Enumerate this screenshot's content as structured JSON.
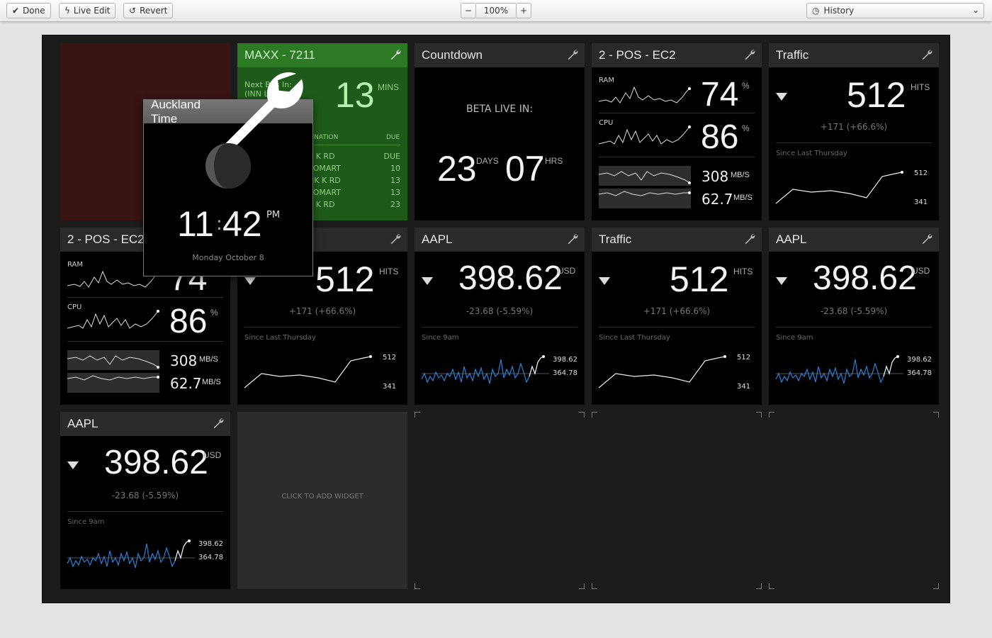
{
  "toolbar": {
    "done_label": "Done",
    "live_edit_label": "Live Edit",
    "revert_label": "Revert",
    "zoom_minus": "−",
    "zoom_value": "100%",
    "zoom_plus": "+",
    "history_label": "History"
  },
  "widgets": {
    "bus": {
      "title": "MAXX - 7211",
      "next_label": "Next Bus In:",
      "route": "(INN LNK)",
      "minutes": "13",
      "minutes_unit": "MINS",
      "col_destination": "TINATION",
      "col_due": "DUE",
      "rows": [
        {
          "dest": "K K RD",
          "due": "DUE"
        },
        {
          "dest": "TOMART",
          "due": "10"
        },
        {
          "dest": "NK K RD",
          "due": "13"
        },
        {
          "dest": "TOMART",
          "due": "13"
        },
        {
          "dest": "K K RD",
          "due": "23"
        }
      ]
    },
    "countdown": {
      "title": "Countdown",
      "caption": "BETA LIVE IN:",
      "days": "23",
      "days_unit": "DAYS",
      "hours": "07",
      "hours_unit": "HRS"
    },
    "pos1": {
      "title": "2 - POS - EC2",
      "ram_label": "RAM",
      "ram_value": "74",
      "cpu_label": "CPU",
      "cpu_value": "86",
      "pct": "%",
      "net1_value": "308",
      "net2_value": "62.7",
      "net_unit": "MB/S"
    },
    "pos2": {
      "title": "2 - POS - EC2",
      "ram_label": "RAM",
      "ram_value": "74",
      "cpu_label": "CPU",
      "cpu_value": "86",
      "pct": "%",
      "net1_value": "308",
      "net2_value": "62.7",
      "net_unit": "MB/S"
    },
    "traffic": {
      "title": "Traffic",
      "value": "512",
      "unit": "HITS",
      "change": "+171 (+66.6%)",
      "since": "Since Last Thursday",
      "high": "512",
      "low": "341"
    },
    "aapl": {
      "title": "AAPL",
      "value": "398.62",
      "unit": "USD",
      "change": "-23.68 (-5.59%)",
      "since": "Since 9am",
      "high": "398.62",
      "low": "364.78"
    },
    "add_label": "CLICK TO ADD WIDGET",
    "clock": {
      "title": "Auckland Time",
      "hours": "11",
      "sep": ":",
      "minutes": "42",
      "ampm": "PM",
      "date": "Monday October 8"
    }
  },
  "colors": {
    "bus_bg": "#1f5a1a",
    "bus_text": "#8fd17f",
    "red_cell": "#3a1313",
    "aapl_line": "#2e7fd6"
  }
}
